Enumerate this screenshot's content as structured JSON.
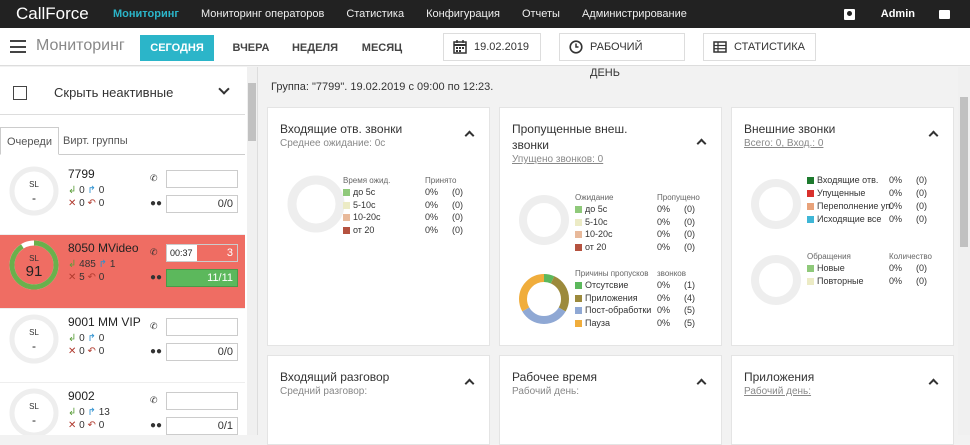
{
  "app": {
    "logo": "CallForce",
    "user": "Admin"
  },
  "nav": [
    "Мониторинг",
    "Мониторинг операторов",
    "Статистика",
    "Конфигурация",
    "Отчеты",
    "Администрирование"
  ],
  "toolbar": {
    "title": "Мониторинг",
    "ranges": [
      "СЕГОДНЯ",
      "ВЧЕРА",
      "НЕДЕЛЯ",
      "МЕСЯЦ"
    ],
    "active_range": "СЕГОДНЯ",
    "date": "19.02.2019",
    "workday": "РАБОЧИЙ ДЕНЬ",
    "stats": "СТАТИСТИКА"
  },
  "left": {
    "hide_inactive": "Скрыть неактивные",
    "tabs": [
      "Очереди",
      "Вирт. группы"
    ],
    "queues": [
      {
        "name": "7799",
        "sl_label": "SL",
        "sl_value": "-",
        "in": "0",
        "out": "0",
        "lost": "0",
        "cb": "0",
        "timer": "",
        "waiting": "",
        "agents": "0/0",
        "sl_fill": 0,
        "alert": false
      },
      {
        "name": "8050 MVideo",
        "sl_label": "SL",
        "sl_value": "91",
        "in": "485",
        "out": "1",
        "lost": "5",
        "cb": "0",
        "timer": "00:37",
        "waiting": "3",
        "agents": "11/11",
        "sl_fill": 0.91,
        "alert": true
      },
      {
        "name": "9001 MM VIP",
        "sl_label": "SL",
        "sl_value": "-",
        "in": "0",
        "out": "0",
        "lost": "0",
        "cb": "0",
        "timer": "",
        "waiting": "",
        "agents": "0/0",
        "sl_fill": 0,
        "alert": false
      },
      {
        "name": "9002",
        "sl_label": "SL",
        "sl_value": "-",
        "in": "0",
        "out": "13",
        "lost": "0",
        "cb": "0",
        "timer": "",
        "waiting": "",
        "agents": "0/1",
        "sl_fill": 0,
        "alert": false
      }
    ]
  },
  "group_title": "Группа: \"7799\". 19.02.2019 с 09:00 по 12:23.",
  "cards": {
    "incoming": {
      "title": "Входящие отв. звонки",
      "subtitle": "Среднее ожидание: 0с",
      "col1": "Время ожид.",
      "col2": "Принято",
      "rows": [
        {
          "label": "до 5с",
          "pct": "0%",
          "cnt": "(0)",
          "color": "#8fc97a"
        },
        {
          "label": "5-10с",
          "pct": "0%",
          "cnt": "(0)",
          "color": "#ecebc5"
        },
        {
          "label": "10-20с",
          "pct": "0%",
          "cnt": "(0)",
          "color": "#e8b99a"
        },
        {
          "label": "от 20",
          "pct": "0%",
          "cnt": "(0)",
          "color": "#b5523f"
        }
      ]
    },
    "missed": {
      "title": "Пропущенные внеш. звонки",
      "subtitle": "Упущено звонков: 0",
      "col1": "Ожидание",
      "col2": "Пропущено",
      "rows": [
        {
          "label": "до 5с",
          "pct": "0%",
          "cnt": "(0)",
          "color": "#8fc97a"
        },
        {
          "label": "5-10с",
          "pct": "0%",
          "cnt": "(0)",
          "color": "#ecebc5"
        },
        {
          "label": "10-20с",
          "pct": "0%",
          "cnt": "(0)",
          "color": "#e8b99a"
        },
        {
          "label": "от 20",
          "pct": "0%",
          "cnt": "(0)",
          "color": "#b5523f"
        }
      ],
      "reasons_col1": "Причины пропусков",
      "reasons_col2": "звонков",
      "reasons": [
        {
          "label": "Отсутсвие",
          "pct": "0%",
          "cnt": "(1)",
          "color": "#5cb85c",
          "value": 1
        },
        {
          "label": "Приложения",
          "pct": "0%",
          "cnt": "(4)",
          "color": "#9c8a3c",
          "value": 4
        },
        {
          "label": "Пост-обработки",
          "pct": "0%",
          "cnt": "(5)",
          "color": "#8fa8d4",
          "value": 5
        },
        {
          "label": "Пауза",
          "pct": "0%",
          "cnt": "(5)",
          "color": "#f0ad3c",
          "value": 5
        }
      ]
    },
    "external": {
      "title": "Внешние звонки",
      "subtitle": "Всего: 0, Вход.: 0",
      "rows": [
        {
          "label": "Входящие отв.",
          "pct": "0%",
          "cnt": "(0)",
          "color": "#1e7a2e"
        },
        {
          "label": "Упущенные",
          "pct": "0%",
          "cnt": "(0)",
          "color": "#d9302c"
        },
        {
          "label": "Переполнение уп.",
          "pct": "0%",
          "cnt": "(0)",
          "color": "#e8a27a"
        },
        {
          "label": "Исходящие все",
          "pct": "0%",
          "cnt": "(0)",
          "color": "#3fb6d6"
        }
      ],
      "col1": "Обращения",
      "col2": "Количество",
      "rows2": [
        {
          "label": "Новые",
          "pct": "0%",
          "cnt": "(0)",
          "color": "#8fc97a"
        },
        {
          "label": "Повторные",
          "pct": "0%",
          "cnt": "(0)",
          "color": "#ecebc5"
        }
      ]
    },
    "talk": {
      "title": "Входящий разговор",
      "subtitle": "Средний разговор:"
    },
    "worktime": {
      "title": "Рабочее время",
      "subtitle": "Рабочий день:"
    },
    "apps": {
      "title": "Приложения",
      "subtitle": "Рабочий день:"
    }
  }
}
